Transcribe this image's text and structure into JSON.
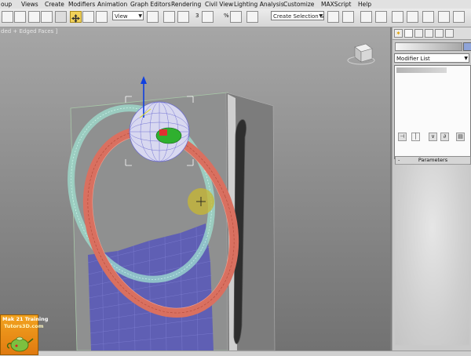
{
  "menu": {
    "items": [
      "oup",
      "Views",
      "Create",
      "Modifiers",
      "Animation",
      "Graph Editors",
      "Rendering",
      "Civil View",
      "Lighting Analysis",
      "Customize",
      "MAXScript",
      "Help"
    ]
  },
  "toolbar": {
    "reference_coord": "View",
    "snap_value": "3",
    "percent_label": "%",
    "selection_set_placeholder": "Create Selection Se"
  },
  "viewport": {
    "label": "ded + Edged Faces ]"
  },
  "command_panel": {
    "modifier_list_label": "Modifier List",
    "parameters_title": "Parameters",
    "parameters_sign": "-"
  },
  "watermark": {
    "line1": "Mak 21 Training",
    "line2": "Tutors3D.com"
  },
  "colors": {
    "torus": "#d97060",
    "selection_wire": "#9fe0d0",
    "cloth": "#5a5ab8",
    "gizmo_axis": "#1040e0",
    "accent_active_tool": "#f2d25a",
    "cursor_highlight": "#c8b830"
  }
}
